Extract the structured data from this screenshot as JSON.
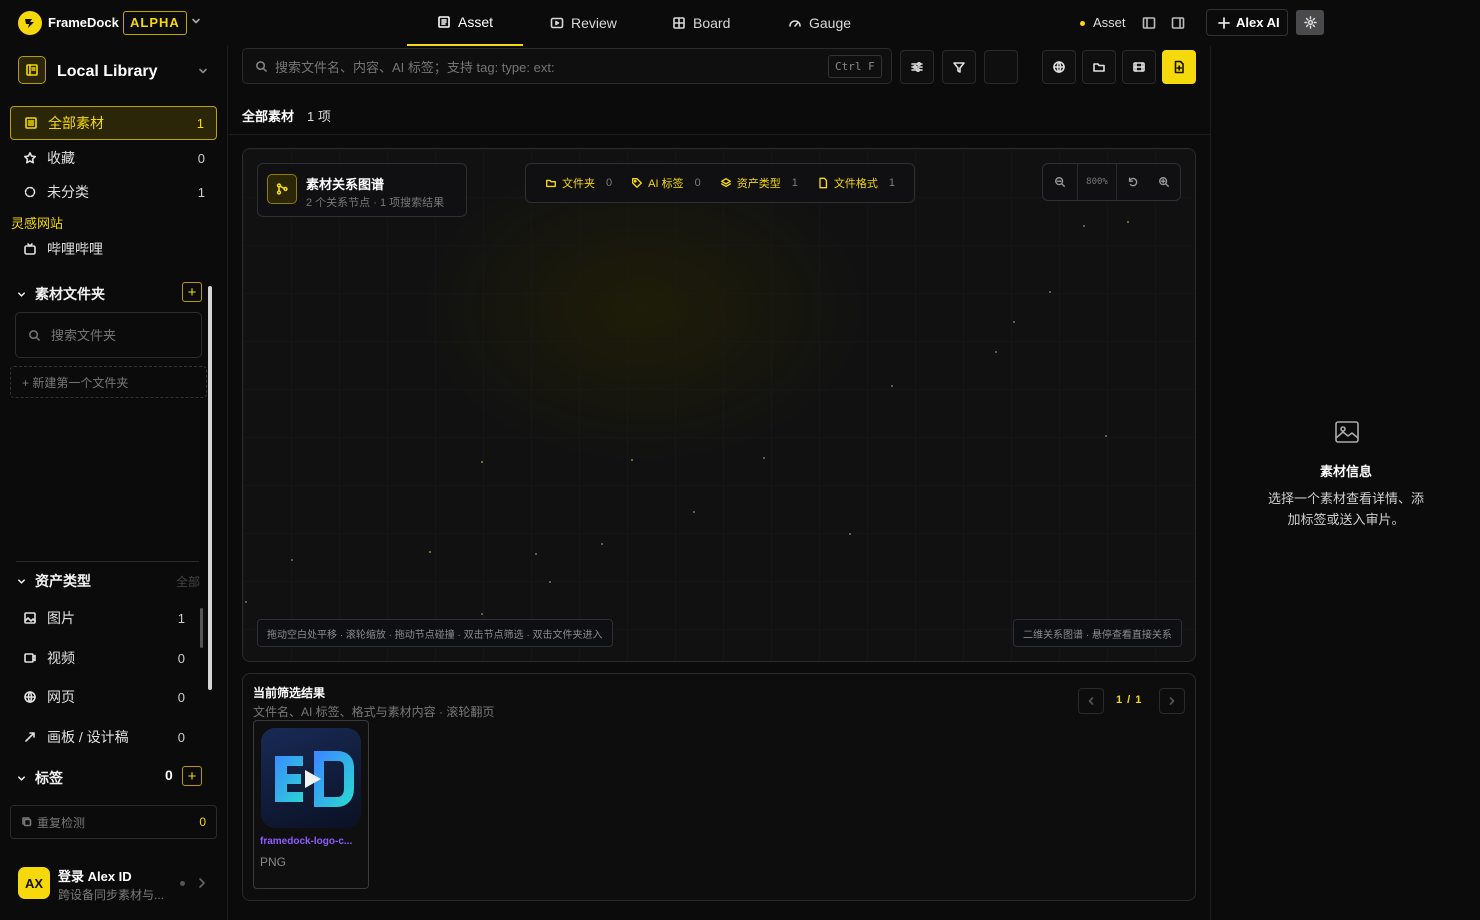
{
  "app": {
    "name": "FrameDock",
    "badge": "ALPHA",
    "brand_color": "#f5d90a"
  },
  "top_tabs": [
    {
      "label": "Asset",
      "icon": "asset-icon",
      "active": true
    },
    {
      "label": "Review",
      "icon": "play-square-icon",
      "active": false
    },
    {
      "label": "Board",
      "icon": "grid-icon",
      "active": false
    },
    {
      "label": "Gauge",
      "icon": "gauge-icon",
      "active": false
    }
  ],
  "top_right": {
    "status_label": "Asset",
    "ai_label": "Alex AI"
  },
  "library": {
    "title": "Local Library"
  },
  "nav": [
    {
      "label": "全部素材",
      "count": "1",
      "icon": "list-icon",
      "active": true
    },
    {
      "label": "收藏",
      "count": "0",
      "icon": "star-icon"
    },
    {
      "label": "未分类",
      "count": "1",
      "icon": "dashed-circle-icon"
    }
  ],
  "inspiration": {
    "heading": "灵感网站",
    "items": [
      {
        "label": "哔哩哔哩",
        "icon": "tv-icon"
      }
    ]
  },
  "folders": {
    "title": "素材文件夹",
    "search_placeholder": "搜索文件夹",
    "new_label": "+ 新建第一个文件夹"
  },
  "asset_types": {
    "title": "资产类型",
    "all_label": "全部",
    "items": [
      {
        "label": "图片",
        "count": "1",
        "icon": "image-icon"
      },
      {
        "label": "视频",
        "count": "0",
        "icon": "video-icon"
      },
      {
        "label": "网页",
        "count": "0",
        "icon": "globe-icon"
      },
      {
        "label": "画板 / 设计稿",
        "count": "0",
        "icon": "design-icon"
      }
    ]
  },
  "tags": {
    "title": "标签",
    "count": "0"
  },
  "duplicate": {
    "label": "重复检测",
    "count": "0"
  },
  "account": {
    "avatar": "AX",
    "title": "登录 Alex ID",
    "subtitle": "跨设备同步素材与..."
  },
  "search": {
    "placeholder": "搜索文件名、内容、AI 标签；支持 tag: type: ext:",
    "shortcut": "Ctrl F"
  },
  "header": {
    "title": "全部素材",
    "count": "1 项"
  },
  "graph": {
    "title": "素材关系图谱",
    "subtitle": "2 个关系节点 · 1 项搜索结果",
    "chips": [
      {
        "label": "文件夹",
        "count": "0",
        "icon": "folder-icon"
      },
      {
        "label": "AI 标签",
        "count": "0",
        "icon": "tag-icon"
      },
      {
        "label": "资产类型",
        "count": "1",
        "icon": "layers-icon"
      },
      {
        "label": "文件格式",
        "count": "1",
        "icon": "file-icon"
      }
    ],
    "zoom": "800%",
    "hint_left": "拖动空白处平移 · 滚轮缩放 · 拖动节点碰撞 · 双击节点筛选 · 双击文件夹进入",
    "hint_right": "二维关系图谱 · 悬停查看直接关系"
  },
  "results": {
    "title": "当前筛选结果",
    "subtitle": "文件名、AI 标签、格式与素材内容 · 滚轮翻页",
    "page": "1 / 1",
    "items": [
      {
        "name": "framedock-logo-c...",
        "format": "PNG"
      }
    ]
  },
  "info": {
    "title": "素材信息",
    "text_line1": "选择一个素材查看详情、添",
    "text_line2": "加标签或送入审片。"
  }
}
